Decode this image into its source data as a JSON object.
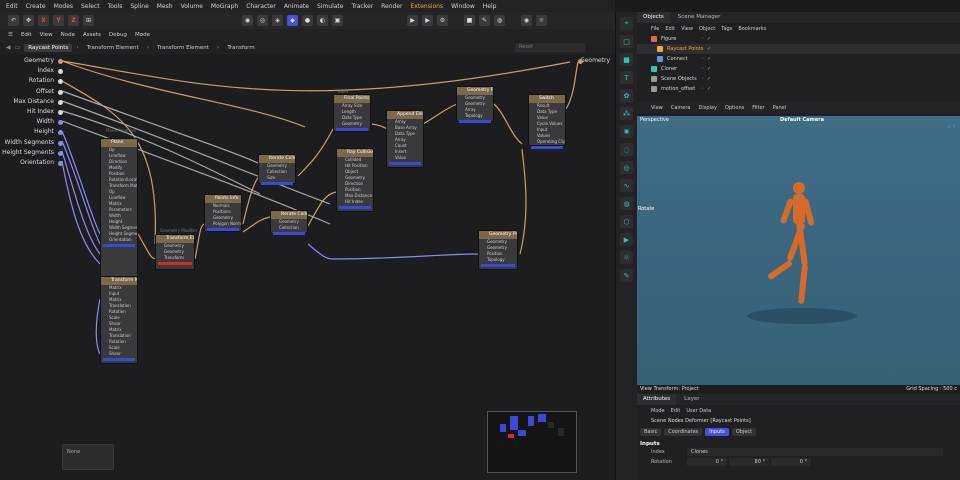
{
  "menu": [
    "Edit",
    "Create",
    "Modes",
    "Select",
    "Tools",
    "Spline",
    "Mesh",
    "Volume",
    "MoGraph",
    "Character",
    "Animate",
    "Simulate",
    "Tracker",
    "Render",
    "Extensions",
    "Window",
    "Help"
  ],
  "toolbar_axes": [
    "X",
    "Y",
    "Z"
  ],
  "node_menu": [
    "Edit",
    "View",
    "Node",
    "Assets",
    "Debug",
    "Mode"
  ],
  "breadcrumbs": [
    "Raycast Points",
    "Transform Element",
    "Transform Element",
    "Transform"
  ],
  "reset_placeholder": "Reset",
  "inputs": [
    "Geometry",
    "Index",
    "Rotation",
    "Offset",
    "Max Distance",
    "Hit Index",
    "Width",
    "Height",
    "Width Segments",
    "Height Segments",
    "Orientation"
  ],
  "output_label": "Geometry",
  "nodes": {
    "plane": {
      "title": "Plane",
      "rows": [
        "Op",
        "Lineflow",
        "Direction",
        "Modify",
        "Position",
        "Rotation/Location",
        "Transform Matrix",
        "Op",
        "Lineflow",
        "Matrix",
        "Parameters",
        "Width",
        "Height",
        "Width Segments",
        "Height Segments",
        "Orientation"
      ]
    },
    "transform_matrices": {
      "title": "Transform Matrices",
      "rows": [
        "Matrix",
        "Input",
        "Matrix",
        "Translation",
        "Rotation",
        "Scale",
        "Shear",
        "Matrix",
        "Translation",
        "Rotation",
        "Scale",
        "Shear"
      ]
    },
    "transform_element": {
      "title": "Transform Element",
      "rows": [
        "Geometry",
        "Geometry",
        "Transform"
      ]
    },
    "points_info": {
      "title": "Points Info",
      "rows": [
        "Normals",
        "Positions",
        "Geometry",
        "Polygon Normals"
      ]
    },
    "iterate_collection_1": {
      "title": "Iterate Collection",
      "rows": [
        "Geometry",
        "Collection",
        "Size"
      ]
    },
    "iterate_collection_2": {
      "title": "Iterate Collection",
      "rows": [
        "Geometry",
        "Collection"
      ]
    },
    "final_points_array": {
      "title": "Final Points Array",
      "rows": [
        "Array Size",
        "Length",
        "Data Type",
        "Geometry"
      ]
    },
    "ray_collision": {
      "title": "Ray Collision",
      "rows": [
        "Collided",
        "Hit Position",
        "Object",
        "Geometry",
        "Direction",
        "Position",
        "Max Distance",
        "Hit Index"
      ]
    },
    "append_elements": {
      "title": "Append Elements",
      "rows": [
        "Array",
        "Base Array",
        "Data Type",
        "Array",
        "Count",
        "Insert",
        "Value"
      ]
    },
    "geometry_property_set_1": {
      "title": "Geometry Property Set",
      "rows": [
        "Geometry",
        "Geometry",
        "Array",
        "Topology"
      ]
    },
    "switch": {
      "title": "Switch",
      "rows": [
        "Result",
        "Data Type",
        "Value",
        "Cycle Values",
        "Input",
        "Values",
        "Operating Clip"
      ]
    },
    "geometry_property_set_2": {
      "title": "Geometry Property Set",
      "rows": [
        "Geometry",
        "Geometry",
        "Position",
        "Topology"
      ]
    }
  },
  "sub_labels": {
    "build": "Build",
    "geometry_modifier": "Geometry Modifier",
    "plane": "Plane Primitive"
  },
  "status_box": "None",
  "objects_panel": {
    "tabs": [
      "Objects",
      "Scene Manager"
    ],
    "menu": [
      "File",
      "Edit",
      "View",
      "Object",
      "Tags",
      "Bookmarks"
    ],
    "rows": [
      {
        "label": "Figure",
        "color": "#e06a3a",
        "selected": false
      },
      {
        "label": "Raycast Points",
        "color": "#f0a83a",
        "selected": true
      },
      {
        "label": "Connect",
        "color": "#5a9be0",
        "selected": false
      },
      {
        "label": "Cloner",
        "color": "#2ac6b8",
        "selected": false
      },
      {
        "label": "Scene Objects",
        "color": "#999999",
        "selected": false
      },
      {
        "label": "motion_offset",
        "color": "#999999",
        "selected": false
      }
    ]
  },
  "viewport": {
    "menu": [
      "View",
      "Camera",
      "Display",
      "Options",
      "Filter",
      "Panel"
    ],
    "mode": "Perspective",
    "camera": "Default Camera",
    "tool": "Rotate",
    "view_transform": "View Transform: Project",
    "grid_spacing": "Grid Spacing : 500 c"
  },
  "attributes": {
    "tabs": [
      "Attributes",
      "Layer"
    ],
    "menu": [
      "Mode",
      "Edit",
      "User Data"
    ],
    "title": "Scene Nodes Deformer [Raycast Points]",
    "chips": [
      "Basic",
      "Coordinates",
      "Inputs",
      "Object"
    ],
    "active_chip": "Inputs",
    "section": "Inputs",
    "fields": [
      {
        "name": "Index",
        "value": "Clones"
      },
      {
        "name": "Rotation",
        "values": [
          "0 °",
          "80 °",
          "0 °"
        ]
      }
    ]
  },
  "colors": {
    "accent": "#f0a83a",
    "blue": "#3c48d8",
    "teal": "#2ac6b8",
    "red": "#d82828"
  }
}
